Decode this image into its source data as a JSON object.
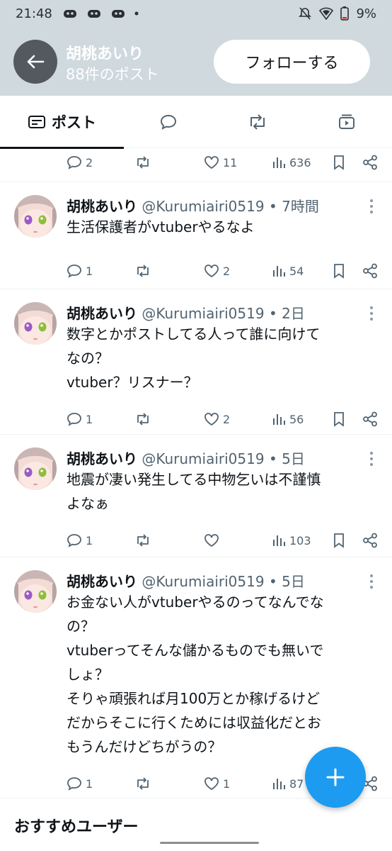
{
  "status_bar": {
    "time": "21:48",
    "battery": "9%"
  },
  "header": {
    "name": "胡桃あいり",
    "post_count": "88件のポスト",
    "follow_label": "フォローする"
  },
  "tabs": [
    {
      "label": "ポスト",
      "active": true
    }
  ],
  "partial_post": {
    "replies": "2",
    "likes": "11",
    "views": "636"
  },
  "posts": [
    {
      "name": "胡桃あいり",
      "meta": "@Kurumiairi0519 • 7時間",
      "lines": [
        "生活保護者がvtuberやるなよ"
      ],
      "replies": "1",
      "likes": "2",
      "views": "54"
    },
    {
      "name": "胡桃あいり",
      "meta": "@Kurumiairi0519 • 2日",
      "lines": [
        "数字とかポストしてる人って誰に向けて",
        "なの？",
        "vtuber？リスナー？"
      ],
      "replies": "1",
      "likes": "2",
      "views": "56"
    },
    {
      "name": "胡桃あいり",
      "meta": "@Kurumiairi0519 • 5日",
      "lines": [
        "地震が凄い発生してる中物乞いは不謹慎",
        "よなぁ"
      ],
      "replies": "1",
      "likes": "",
      "views": "103"
    },
    {
      "name": "胡桃あいり",
      "meta": "@Kurumiairi0519 • 5日",
      "lines": [
        "お金ない人がvtuberやるのってなんでな",
        "の？",
        "vtuberってそんな儲かるものでも無いで",
        "しょ？",
        "そりゃ頑張れば月100万とか稼げるけど",
        "だからそこに行くためには収益化だとお",
        "もうんだけどちがうの？"
      ],
      "replies": "1",
      "likes": "1",
      "views": "87"
    }
  ],
  "recommend": {
    "title": "おすすめユーザー"
  },
  "colors": {
    "accent": "#1d9bf0",
    "header_bg": "#cfd9de",
    "muted": "#536471"
  }
}
